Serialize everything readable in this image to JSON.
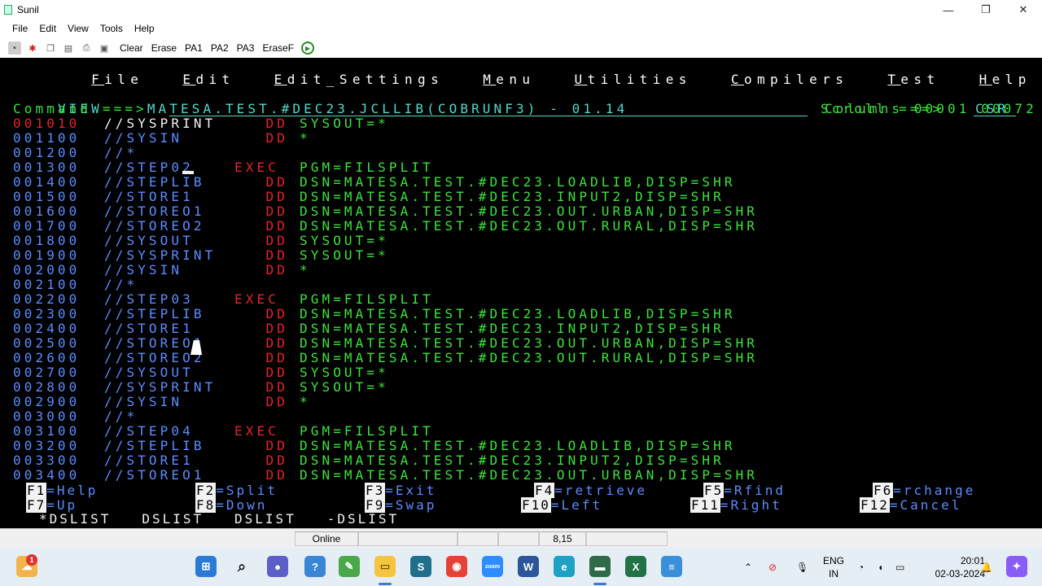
{
  "window": {
    "title": "Sunil",
    "minimize": "—",
    "restore": "❐",
    "close": "✕"
  },
  "menu": [
    "File",
    "Edit",
    "View",
    "Tools",
    "Help"
  ],
  "toolbar": {
    "labels": [
      "Clear",
      "Erase",
      "PA1",
      "PA2",
      "PA3",
      "EraseF"
    ]
  },
  "ispf": {
    "menu_items": [
      "File",
      "Edit",
      "Edit_Settings",
      "Menu",
      "Utilities",
      "Compilers",
      "Test",
      "Help"
    ],
    "mode": "VIEW",
    "dataset": "MATESA.TEST.#DEC23.JCLLIB(COBRUNF3) - 01.14",
    "columns_label": "Columns",
    "col_start": "00001",
    "col_end": "00072",
    "command_label": "Command ===>",
    "scroll_label": "Scroll ===>",
    "scroll_value": "CSR",
    "lines": [
      {
        "num": "001010",
        "name": "//SYSPRINT",
        "op": "DD",
        "param": "SYSOUT=*",
        "first": true
      },
      {
        "num": "001100",
        "name": "//SYSIN",
        "op": "DD",
        "param": "*"
      },
      {
        "num": "001200",
        "name": "//*",
        "op": "",
        "param": ""
      },
      {
        "num": "001300",
        "name": "//STEP02",
        "op": "EXEC",
        "param": "PGM=FILSPLIT"
      },
      {
        "num": "001400",
        "name": "//STEPLIB",
        "op": "DD",
        "param": "DSN=MATESA.TEST.#DEC23.LOADLIB,DISP=SHR"
      },
      {
        "num": "001500",
        "name": "//STORE1",
        "op": "DD",
        "param": "DSN=MATESA.TEST.#DEC23.INPUT2,DISP=SHR"
      },
      {
        "num": "001600",
        "name": "//STOREO1",
        "op": "DD",
        "param": "DSN=MATESA.TEST.#DEC23.OUT.URBAN,DISP=SHR"
      },
      {
        "num": "001700",
        "name": "//STOREO2",
        "op": "DD",
        "param": "DSN=MATESA.TEST.#DEC23.OUT.RURAL,DISP=SHR"
      },
      {
        "num": "001800",
        "name": "//SYSOUT",
        "op": "DD",
        "param": "SYSOUT=*"
      },
      {
        "num": "001900",
        "name": "//SYSPRINT",
        "op": "DD",
        "param": "SYSOUT=*"
      },
      {
        "num": "002000",
        "name": "//SYSIN",
        "op": "DD",
        "param": "*"
      },
      {
        "num": "002100",
        "name": "//*",
        "op": "",
        "param": ""
      },
      {
        "num": "002200",
        "name": "//STEP03",
        "op": "EXEC",
        "param": "PGM=FILSPLIT"
      },
      {
        "num": "002300",
        "name": "//STEPLIB",
        "op": "DD",
        "param": "DSN=MATESA.TEST.#DEC23.LOADLIB,DISP=SHR"
      },
      {
        "num": "002400",
        "name": "//STORE1",
        "op": "DD",
        "param": "DSN=MATESA.TEST.#DEC23.INPUT2,DISP=SHR"
      },
      {
        "num": "002500",
        "name": "//STOREO1",
        "op": "DD",
        "param": "DSN=MATESA.TEST.#DEC23.OUT.URBAN,DISP=SHR"
      },
      {
        "num": "002600",
        "name": "//STOREO2",
        "op": "DD",
        "param": "DSN=MATESA.TEST.#DEC23.OUT.RURAL,DISP=SHR"
      },
      {
        "num": "002700",
        "name": "//SYSOUT",
        "op": "DD",
        "param": "SYSOUT=*"
      },
      {
        "num": "002800",
        "name": "//SYSPRINT",
        "op": "DD",
        "param": "SYSOUT=*"
      },
      {
        "num": "002900",
        "name": "//SYSIN",
        "op": "DD",
        "param": "*"
      },
      {
        "num": "003000",
        "name": "//*",
        "op": "",
        "param": ""
      },
      {
        "num": "003100",
        "name": "//STEP04",
        "op": "EXEC",
        "param": "PGM=FILSPLIT"
      },
      {
        "num": "003200",
        "name": "//STEPLIB",
        "op": "DD",
        "param": "DSN=MATESA.TEST.#DEC23.LOADLIB,DISP=SHR"
      },
      {
        "num": "003300",
        "name": "//STORE1",
        "op": "DD",
        "param": "DSN=MATESA.TEST.#DEC23.INPUT2,DISP=SHR"
      },
      {
        "num": "003400",
        "name": "//STOREO1",
        "op": "DD",
        "param": "DSN=MATESA.TEST.#DEC23.OUT.URBAN,DISP=SHR"
      }
    ],
    "fkeys_row1": [
      {
        "key": "F1",
        "action": "=Help"
      },
      {
        "key": "F2",
        "action": "=Split"
      },
      {
        "key": "F3",
        "action": "=Exit"
      },
      {
        "key": "F4",
        "action": "=retrieve"
      },
      {
        "key": "F5",
        "action": "=Rfind"
      },
      {
        "key": "F6",
        "action": "=rchange"
      }
    ],
    "fkeys_row2": [
      {
        "key": "F7",
        "action": "=Up"
      },
      {
        "key": "F8",
        "action": "=Down"
      },
      {
        "key": "F9",
        "action": "=Swap"
      },
      {
        "key": "F10",
        "action": "=Left"
      },
      {
        "key": "F11",
        "action": "=Right"
      },
      {
        "key": "F12",
        "action": "=Cancel"
      }
    ],
    "dslist_bar": "*DSLIST   DSLIST   DSLIST   -DSLIST"
  },
  "status": {
    "state": "Online",
    "cursor": "8,15"
  },
  "taskbar": {
    "weather_badge": "1",
    "lang_top": "ENG",
    "lang_bottom": "IN",
    "time": "20:01",
    "date": "02-03-2024",
    "apps": [
      "windows-start-icon",
      "search-icon",
      "teams-icon",
      "chrome-badge-icon",
      "notepad-icon",
      "file-explorer-icon",
      "app-s-icon",
      "chrome-icon",
      "zoom-icon",
      "word-icon",
      "edge-icon",
      "terminal-emulator-icon",
      "excel-icon",
      "notes-icon"
    ],
    "colors": {
      "green": "#3ce33c",
      "blue": "#5d8cff",
      "red": "#e8222a",
      "teal": "#52d9c9"
    }
  }
}
